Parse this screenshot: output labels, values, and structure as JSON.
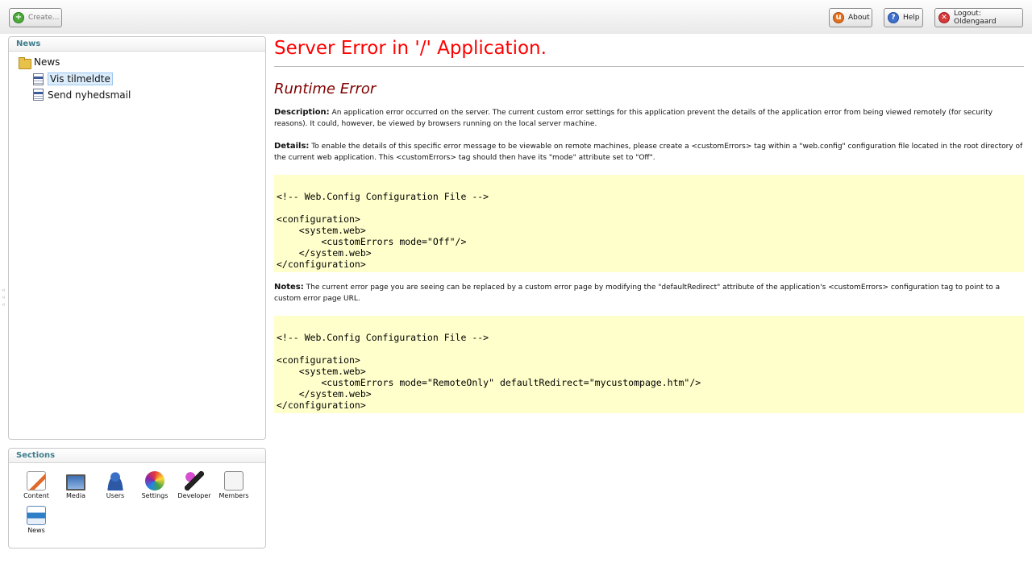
{
  "toolbar": {
    "create_label": "Create...",
    "about_label": "About",
    "help_label": "Help",
    "logout_label": "Logout: Oldengaard"
  },
  "tree": {
    "header": "News",
    "root": "News",
    "children": [
      "Vis tilmeldte",
      "Send nyhedsmail"
    ]
  },
  "sections": {
    "header": "Sections",
    "items": [
      "Content",
      "Media",
      "Users",
      "Settings",
      "Developer",
      "Members",
      "News"
    ]
  },
  "error": {
    "title": "Server Error in '/' Application.",
    "subtitle": "Runtime Error",
    "description_label": "Description:",
    "description_text": " An application error occurred on the server. The current custom error settings for this application prevent the details of the application error from being viewed remotely (for security reasons). It could, however, be viewed by browsers running on the local server machine.",
    "details_label": "Details:",
    "details_text": " To enable the details of this specific error message to be viewable on remote machines, please create a <customErrors> tag within a \"web.config\" configuration file located in the root directory of the current web application. This <customErrors> tag should then have its \"mode\" attribute set to \"Off\".",
    "code1": "\n<!-- Web.Config Configuration File -->\n\n<configuration>\n    <system.web>\n        <customErrors mode=\"Off\"/>\n    </system.web>\n</configuration>",
    "notes_label": "Notes:",
    "notes_text": " The current error page you are seeing can be replaced by a custom error page by modifying the \"defaultRedirect\" attribute of the application's <customErrors> configuration tag to point to a custom error page URL.",
    "code2": "\n<!-- Web.Config Configuration File -->\n\n<configuration>\n    <system.web>\n        <customErrors mode=\"RemoteOnly\" defaultRedirect=\"mycustompage.htm\"/>\n    </system.web>\n</configuration>"
  }
}
